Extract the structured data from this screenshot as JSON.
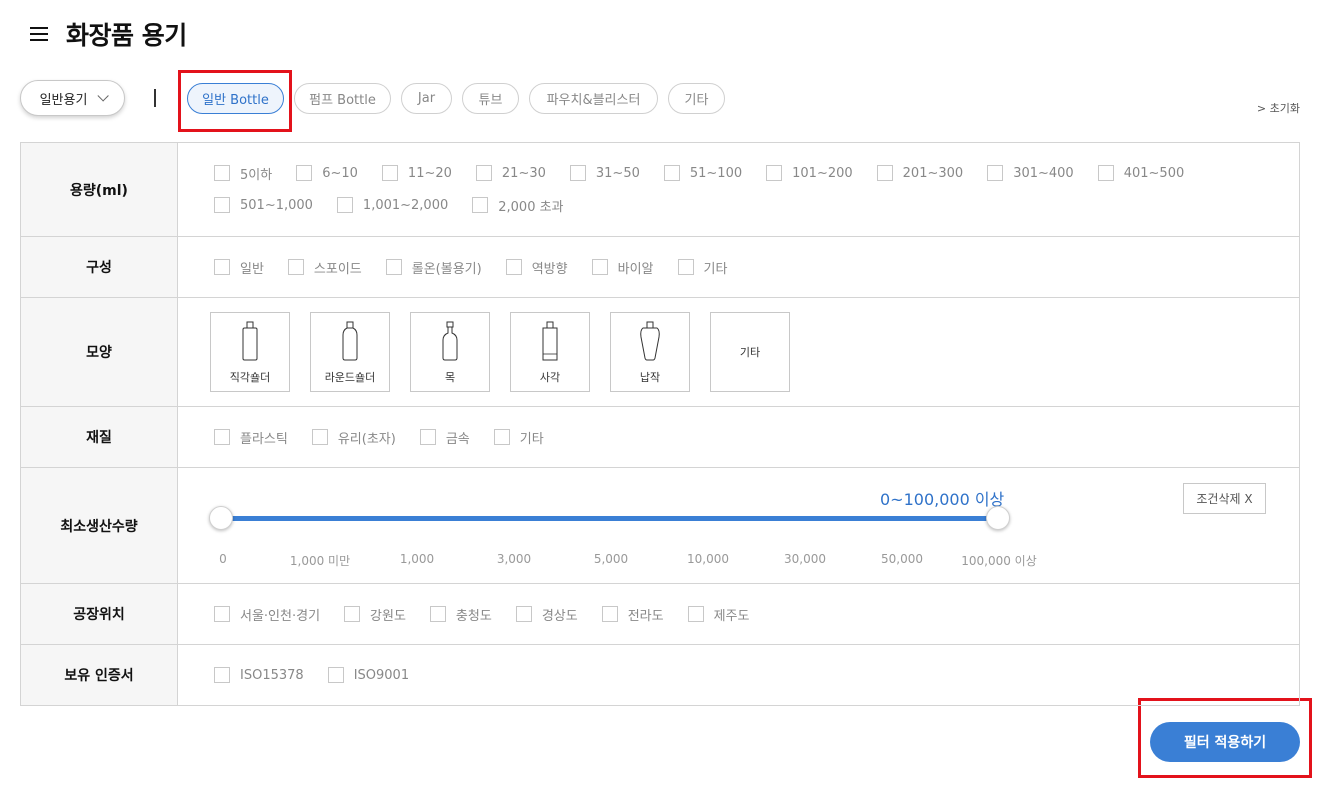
{
  "header": {
    "title": "화장품 용기"
  },
  "category": {
    "select_value": "일반용기",
    "pills": [
      {
        "label": "일반 Bottle",
        "active": true
      },
      {
        "label": "펌프 Bottle",
        "active": false
      },
      {
        "label": "Jar",
        "active": false
      },
      {
        "label": "튜브",
        "active": false
      },
      {
        "label": "파우치&블리스터",
        "active": false
      },
      {
        "label": "기타",
        "active": false
      }
    ],
    "reset_label": "> 초기화"
  },
  "filters": {
    "capacity": {
      "label": "용량(ml)",
      "options": [
        "5이하",
        "6~10",
        "11~20",
        "21~30",
        "31~50",
        "51~100",
        "101~200",
        "201~300",
        "301~400",
        "401~500",
        "501~1,000",
        "1,001~2,000",
        "2,000 초과"
      ]
    },
    "composition": {
      "label": "구성",
      "options": [
        "일반",
        "스포이드",
        "롤온(볼용기)",
        "역방향",
        "바이알",
        "기타"
      ]
    },
    "shape": {
      "label": "모양",
      "options": [
        {
          "label": "직각숄더",
          "icon": "square-shoulder-bottle-icon"
        },
        {
          "label": "라운드숄더",
          "icon": "round-shoulder-bottle-icon"
        },
        {
          "label": "목",
          "icon": "neck-bottle-icon"
        },
        {
          "label": "사각",
          "icon": "square-bottle-icon"
        },
        {
          "label": "납작",
          "icon": "flat-bottle-icon"
        },
        {
          "label": "기타",
          "icon": ""
        }
      ]
    },
    "material": {
      "label": "재질",
      "options": [
        "플라스틱",
        "유리(초자)",
        "금속",
        "기타"
      ]
    },
    "moq": {
      "label": "최소생산수량",
      "range_text": "0~100,000 이상",
      "clear_label": "조건삭제 X",
      "ticks": [
        "0",
        "1,000 미만",
        "1,000",
        "3,000",
        "5,000",
        "10,000",
        "30,000",
        "50,000",
        "100,000 이상"
      ],
      "selected_range": [
        0,
        8
      ]
    },
    "factory": {
      "label": "공장위치",
      "options": [
        "서울·인천·경기",
        "강원도",
        "충청도",
        "경상도",
        "전라도",
        "제주도"
      ]
    },
    "certificate": {
      "label": "보유 인증서",
      "options": [
        "ISO15378",
        "ISO9001"
      ]
    }
  },
  "apply": {
    "label": "필터 적용하기"
  },
  "colors": {
    "accent": "#3a7fd5",
    "highlight": "#e3121b"
  }
}
